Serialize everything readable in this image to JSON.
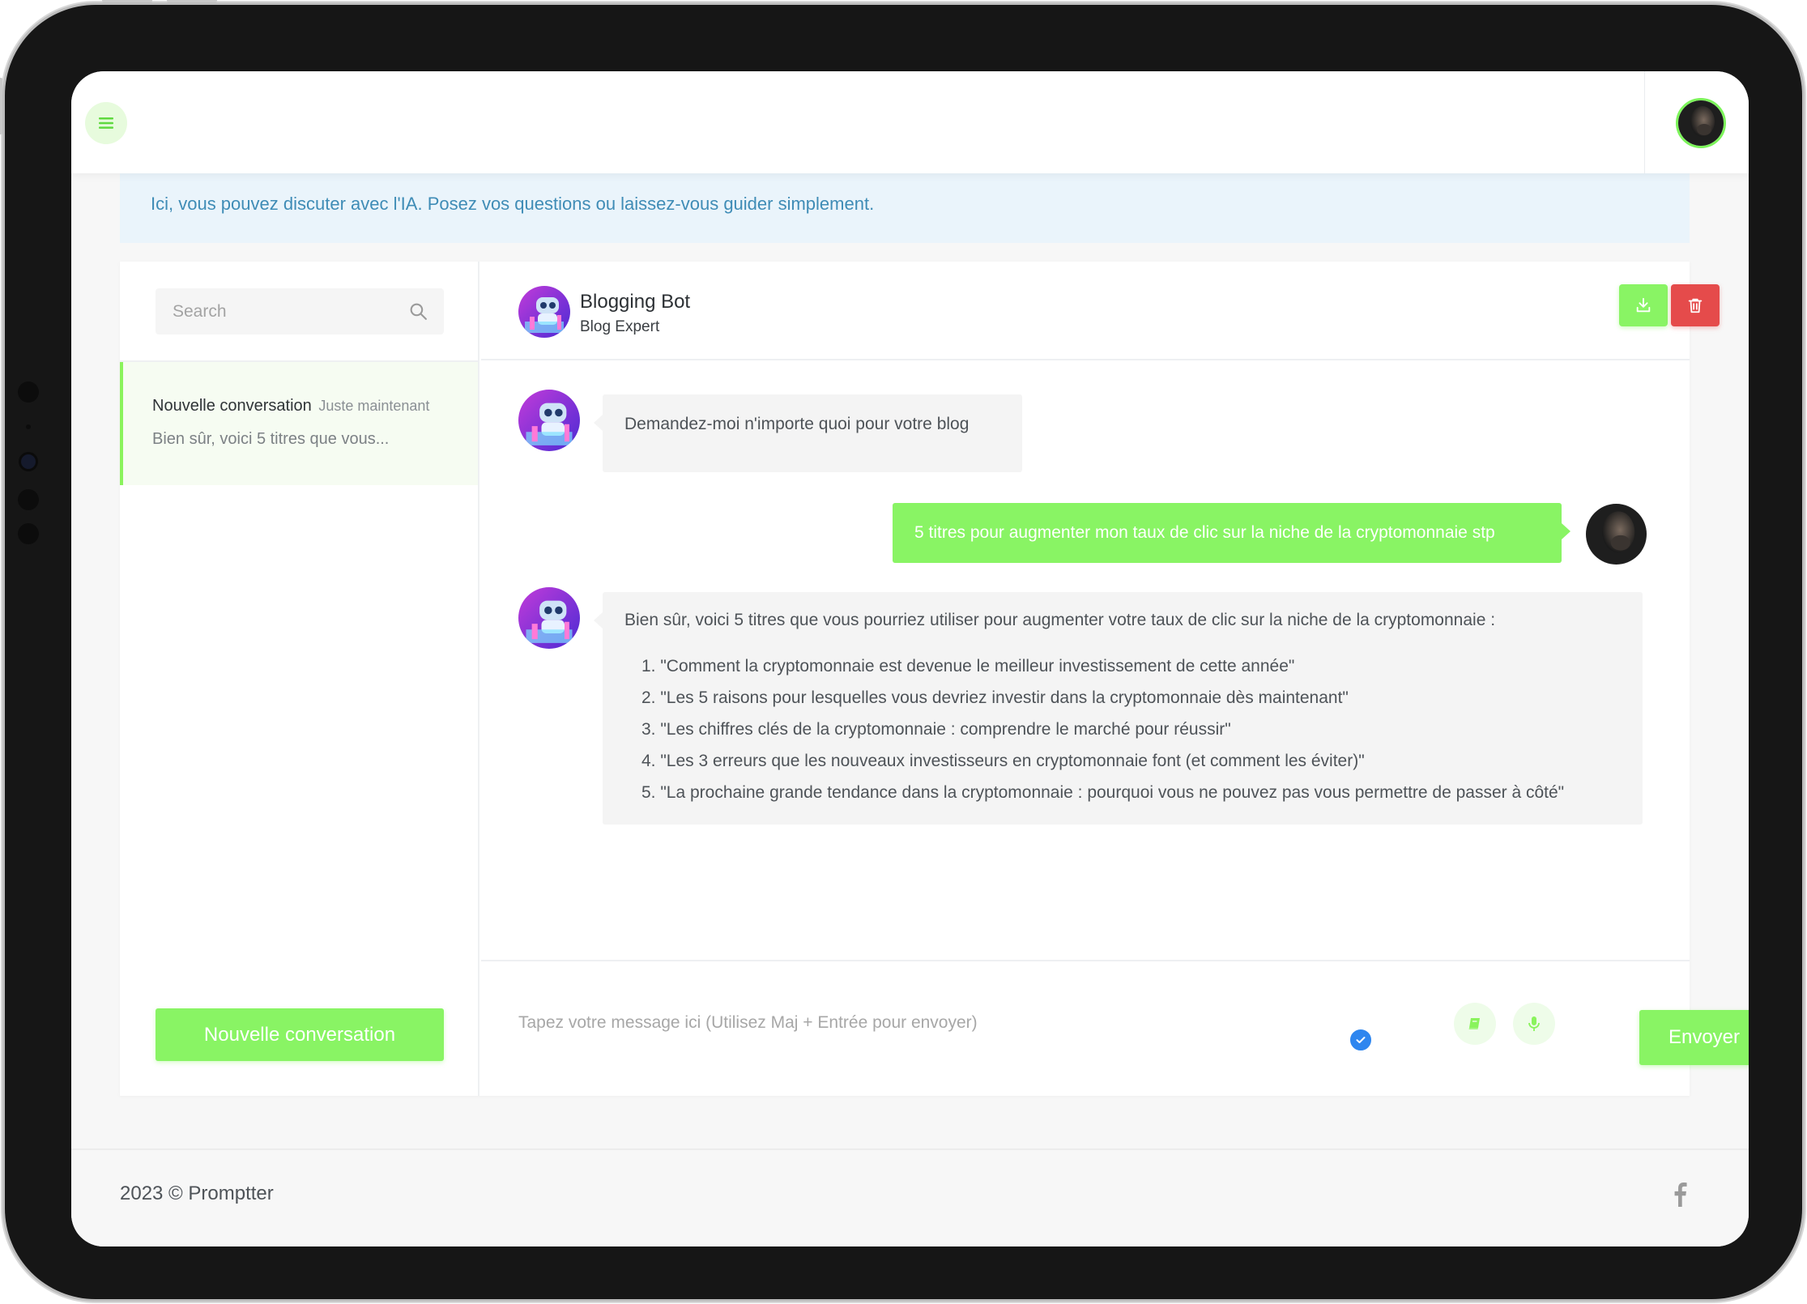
{
  "header": {
    "menu_icon": "hamburger-menu-icon",
    "accent_color": "#89f464"
  },
  "alert": {
    "text": "Ici, vous pouvez discuter avec l'IA. Posez vos questions ou laissez-vous guider simplement."
  },
  "sidebar": {
    "search_placeholder": "Search",
    "conversations": [
      {
        "title": "Nouvelle conversation",
        "time": "Juste maintenant",
        "preview": "Bien sûr, voici 5 titres que vous..."
      }
    ],
    "new_conversation_label": "Nouvelle conversation"
  },
  "chat": {
    "bot_name": "Blogging Bot",
    "bot_role": "Blog Expert",
    "messages": [
      {
        "role": "bot",
        "text": "Demandez-moi n'importe quoi pour votre blog"
      },
      {
        "role": "user",
        "text": "5 titres pour augmenter mon taux de clic sur la niche de la cryptomonnaie stp"
      },
      {
        "role": "bot",
        "intro": "Bien sûr, voici 5 titres que vous pourriez utiliser pour augmenter votre taux de clic sur la niche de la cryptomonnaie :",
        "items": [
          "1. \"Comment la cryptomonnaie est devenue le meilleur investissement de cette année\"",
          "2. \"Les 5 raisons pour lesquelles vous devriez investir dans la cryptomonnaie dès maintenant\"",
          "3. \"Les chiffres clés de la cryptomonnaie : comprendre le marché pour réussir\"",
          "4. \"Les 3 erreurs que les nouveaux investisseurs en cryptomonnaie font (et comment les éviter)\"",
          "5. \"La prochaine grande tendance dans la cryptomonnaie : pourquoi vous ne pouvez pas vous permettre de passer à côté\""
        ]
      }
    ],
    "input_placeholder": "Tapez votre message ici (Utilisez Maj + Entrée pour envoyer)",
    "send_label": "Envoyer",
    "colors": {
      "delete": "#e54b4b",
      "info_text": "#3f8cb6",
      "check_badge": "#2e86ef"
    }
  },
  "footer": {
    "copyright": "2023 © Promptter",
    "social_icon": "facebook-icon"
  }
}
